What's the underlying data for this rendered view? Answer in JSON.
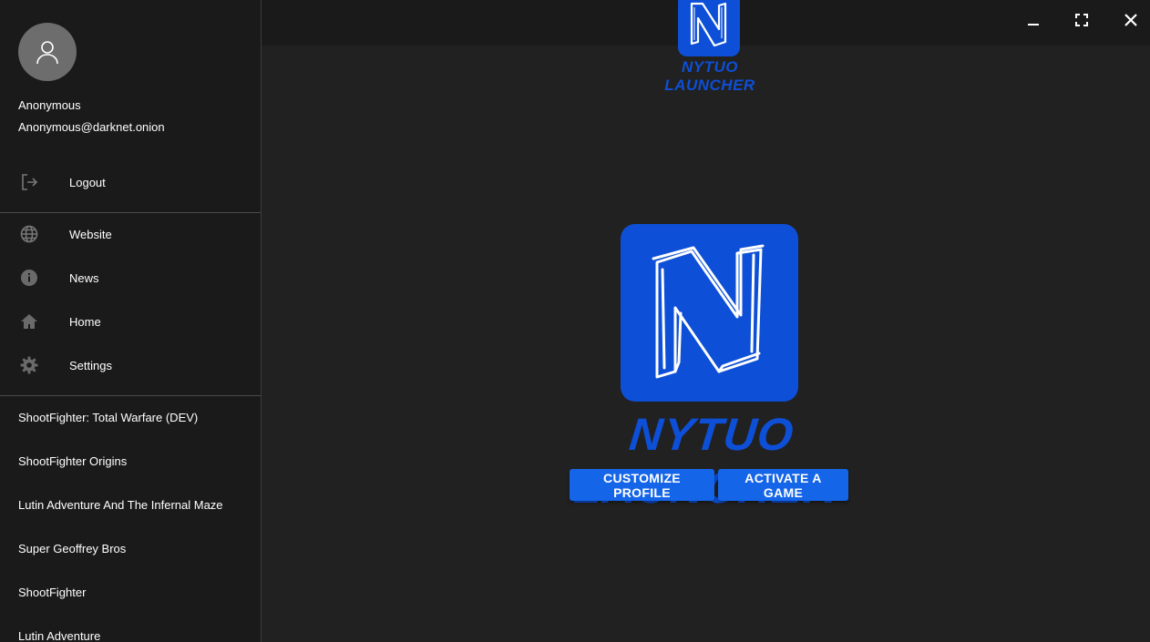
{
  "user": {
    "name": "Anonymous",
    "email": "Anonymous@darknet.onion",
    "avatar_icon": "person-icon"
  },
  "account_menu": {
    "logout_label": "Logout",
    "logout_icon": "exit-icon"
  },
  "nav": {
    "items": [
      {
        "label": "Website",
        "icon": "globe-icon"
      },
      {
        "label": "News",
        "icon": "info-icon"
      },
      {
        "label": "Home",
        "icon": "home-icon"
      },
      {
        "label": "Settings",
        "icon": "gear-icon"
      }
    ]
  },
  "games": [
    "ShootFighter: Total Warfare (DEV)",
    "ShootFighter Origins",
    "Lutin Adventure And The Infernal Maze",
    "Super Geoffrey Bros",
    "ShootFighter",
    "Lutin Adventure"
  ],
  "window_controls": {
    "minimize_icon": "minimize-icon",
    "maximize_icon": "fullscreen-icon",
    "close_icon": "close-icon"
  },
  "brand": {
    "name": "NYTUO LAUNCHER",
    "logo_letter": "N",
    "color": "#0d4fd6"
  },
  "actions": {
    "customize_label": "CUSTOMIZE PROFILE",
    "activate_label": "ACTIVATE A GAME",
    "button_color": "#1565e8"
  }
}
